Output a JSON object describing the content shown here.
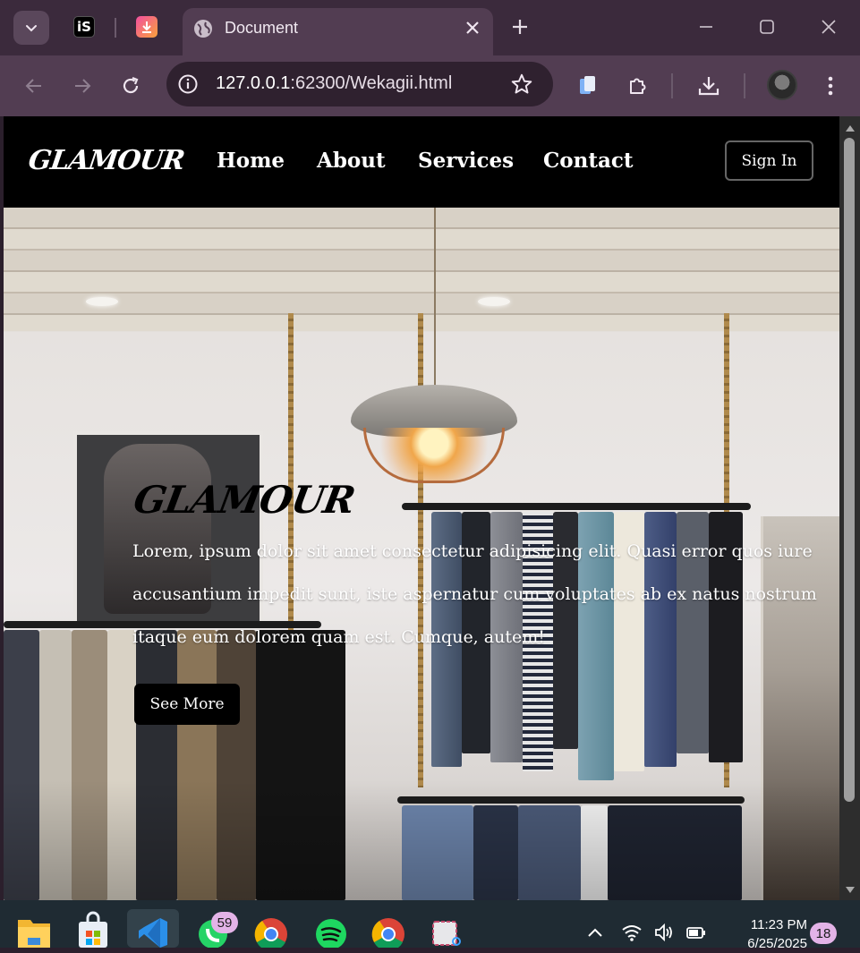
{
  "browser": {
    "tab_title": "Document",
    "url_host": "127.0.0.1",
    "url_rest": ":62300/Wekagii.html",
    "second_tab_icon_text": "iS",
    "accent_color": "#523d52"
  },
  "site": {
    "brand": "GLAMOUR",
    "nav": [
      {
        "label": "Home"
      },
      {
        "label": "About"
      },
      {
        "label": "Services"
      },
      {
        "label": "Contact"
      }
    ],
    "signin_label": "Sign In",
    "hero": {
      "title": "GLAMOUR",
      "text": "Lorem, ipsum dolor sit amet consectetur adipisicing elit. Quasi error quos iure accusantium impedit sunt, iste aspernatur cum voluptates ab ex natus nostrum itaque eum dolorem quam est. Cumque, autem!",
      "button_label": "See More"
    }
  },
  "taskbar": {
    "whatsapp_badge": "59",
    "notification_count": "18",
    "time": "11:23 PM",
    "date": "6/25/2025"
  }
}
